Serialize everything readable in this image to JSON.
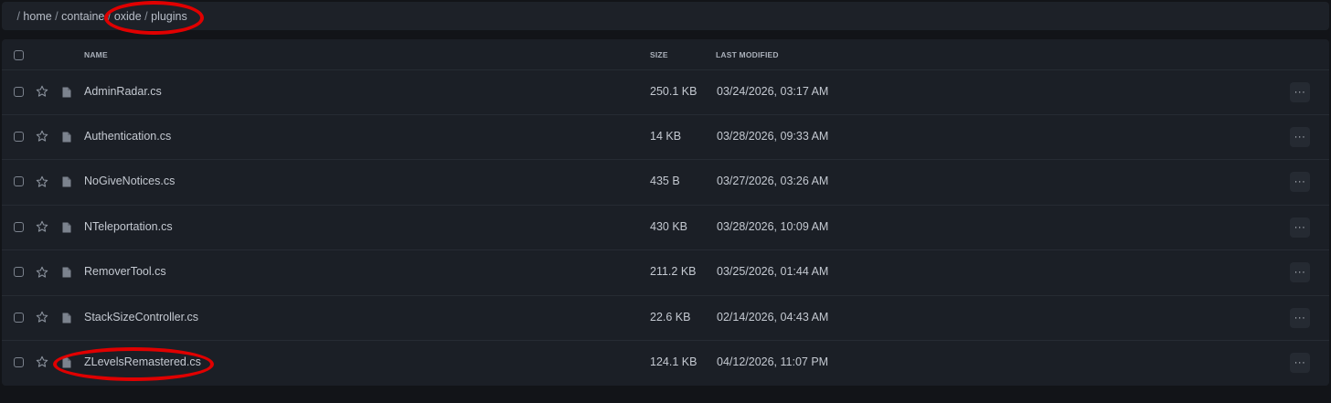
{
  "breadcrumb": {
    "segments": [
      "",
      "home",
      "containe",
      "oxide",
      "plugins"
    ],
    "separator": " / "
  },
  "table": {
    "columns": {
      "name": "NAME",
      "size": "SIZE",
      "last_modified": "LAST MODIFIED"
    },
    "rows": [
      {
        "name": "AdminRadar.cs",
        "size": "250.1 KB",
        "modified": "03/24/2026, 03:17 AM"
      },
      {
        "name": "Authentication.cs",
        "size": "14 KB",
        "modified": "03/28/2026, 09:33 AM"
      },
      {
        "name": "NoGiveNotices.cs",
        "size": "435 B",
        "modified": "03/27/2026, 03:26 AM"
      },
      {
        "name": "NTeleportation.cs",
        "size": "430 KB",
        "modified": "03/28/2026, 10:09 AM"
      },
      {
        "name": "RemoverTool.cs",
        "size": "211.2 KB",
        "modified": "03/25/2026, 01:44 AM"
      },
      {
        "name": "StackSizeController.cs",
        "size": "22.6 KB",
        "modified": "02/14/2026, 04:43 AM"
      },
      {
        "name": "ZLevelsRemastered.cs",
        "size": "124.1 KB",
        "modified": "04/12/2026, 11:07 PM"
      }
    ],
    "row_action_label": "···"
  },
  "icons": {
    "checkbox": "checkbox-icon",
    "favorite": "star-icon",
    "file": "file-icon",
    "more": "more-options-icon"
  },
  "colors": {
    "background": "#121418",
    "panel": "#1b1f26",
    "annotation": "#e00000"
  }
}
